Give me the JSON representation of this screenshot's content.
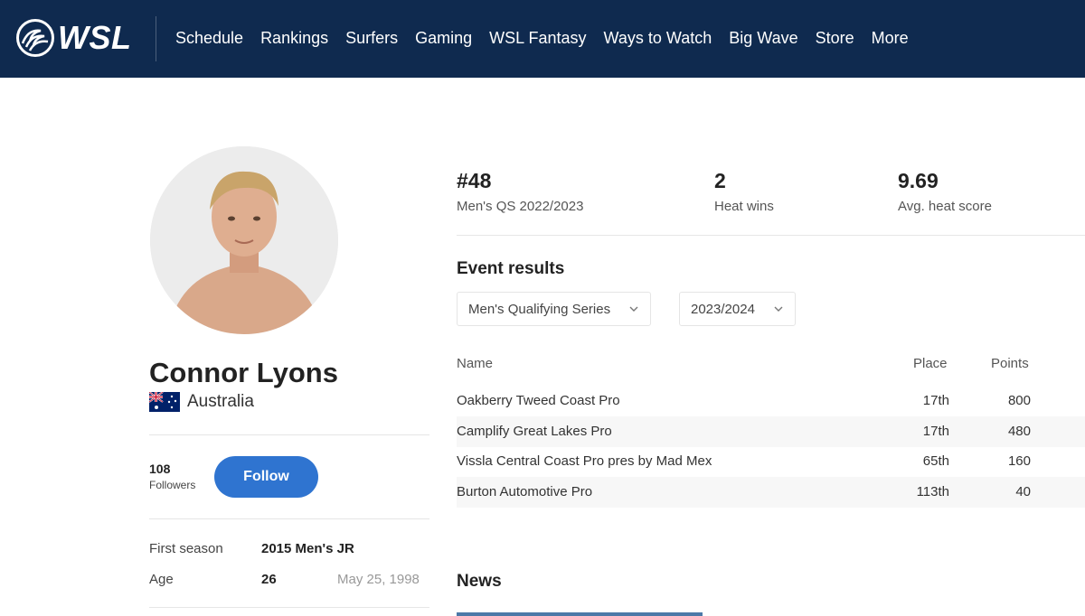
{
  "nav": {
    "logo_text": "WSL",
    "items": [
      "Schedule",
      "Rankings",
      "Surfers",
      "Gaming",
      "WSL Fantasy",
      "Ways to Watch",
      "Big Wave",
      "Store",
      "More"
    ]
  },
  "profile": {
    "name": "Connor Lyons",
    "country": "Australia",
    "followers_count": "108",
    "followers_label": "Followers",
    "follow_label": "Follow",
    "first_season_label": "First season",
    "first_season_value": "2015 Men's JR",
    "age_label": "Age",
    "age_value": "26",
    "birth_date": "May 25, 1998"
  },
  "stats": [
    {
      "value": "#48",
      "label": "Men's QS 2022/2023"
    },
    {
      "value": "2",
      "label": "Heat wins"
    },
    {
      "value": "9.69",
      "label": "Avg. heat score"
    }
  ],
  "event_results": {
    "title": "Event results",
    "tour_select": "Men's Qualifying Series",
    "season_select": "2023/2024",
    "headers": {
      "name": "Name",
      "place": "Place",
      "points": "Points"
    },
    "rows": [
      {
        "name": "Oakberry Tweed Coast Pro",
        "place": "17th",
        "points": "800"
      },
      {
        "name": "Camplify Great Lakes Pro",
        "place": "17th",
        "points": "480"
      },
      {
        "name": "Vissla Central Coast Pro pres by Mad Mex",
        "place": "65th",
        "points": "160"
      },
      {
        "name": "Burton Automotive Pro",
        "place": "113th",
        "points": "40"
      }
    ]
  },
  "news": {
    "title": "News"
  },
  "colors": {
    "nav_bg": "#0f2a4f",
    "follow_button": "#2f74d0"
  }
}
